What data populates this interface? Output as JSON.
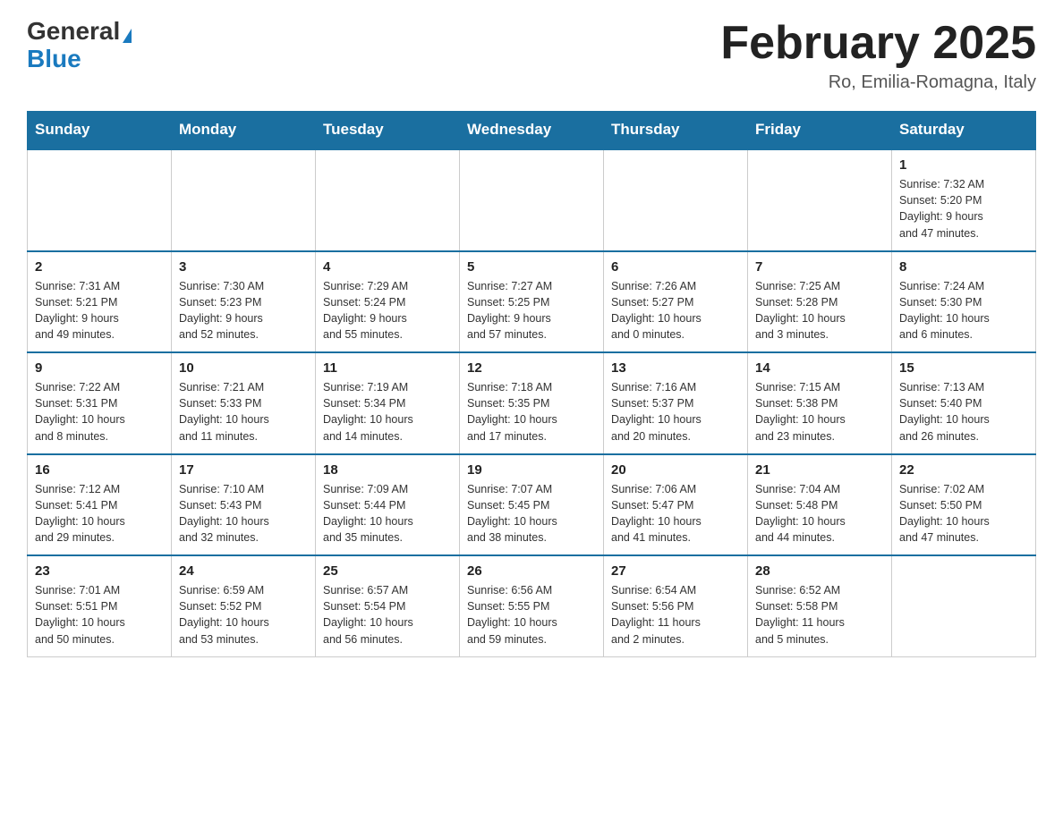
{
  "header": {
    "logo_general": "General",
    "logo_blue": "Blue",
    "month_title": "February 2025",
    "location": "Ro, Emilia-Romagna, Italy"
  },
  "days_of_week": [
    "Sunday",
    "Monday",
    "Tuesday",
    "Wednesday",
    "Thursday",
    "Friday",
    "Saturday"
  ],
  "weeks": [
    [
      {
        "day": "",
        "info": ""
      },
      {
        "day": "",
        "info": ""
      },
      {
        "day": "",
        "info": ""
      },
      {
        "day": "",
        "info": ""
      },
      {
        "day": "",
        "info": ""
      },
      {
        "day": "",
        "info": ""
      },
      {
        "day": "1",
        "info": "Sunrise: 7:32 AM\nSunset: 5:20 PM\nDaylight: 9 hours\nand 47 minutes."
      }
    ],
    [
      {
        "day": "2",
        "info": "Sunrise: 7:31 AM\nSunset: 5:21 PM\nDaylight: 9 hours\nand 49 minutes."
      },
      {
        "day": "3",
        "info": "Sunrise: 7:30 AM\nSunset: 5:23 PM\nDaylight: 9 hours\nand 52 minutes."
      },
      {
        "day": "4",
        "info": "Sunrise: 7:29 AM\nSunset: 5:24 PM\nDaylight: 9 hours\nand 55 minutes."
      },
      {
        "day": "5",
        "info": "Sunrise: 7:27 AM\nSunset: 5:25 PM\nDaylight: 9 hours\nand 57 minutes."
      },
      {
        "day": "6",
        "info": "Sunrise: 7:26 AM\nSunset: 5:27 PM\nDaylight: 10 hours\nand 0 minutes."
      },
      {
        "day": "7",
        "info": "Sunrise: 7:25 AM\nSunset: 5:28 PM\nDaylight: 10 hours\nand 3 minutes."
      },
      {
        "day": "8",
        "info": "Sunrise: 7:24 AM\nSunset: 5:30 PM\nDaylight: 10 hours\nand 6 minutes."
      }
    ],
    [
      {
        "day": "9",
        "info": "Sunrise: 7:22 AM\nSunset: 5:31 PM\nDaylight: 10 hours\nand 8 minutes."
      },
      {
        "day": "10",
        "info": "Sunrise: 7:21 AM\nSunset: 5:33 PM\nDaylight: 10 hours\nand 11 minutes."
      },
      {
        "day": "11",
        "info": "Sunrise: 7:19 AM\nSunset: 5:34 PM\nDaylight: 10 hours\nand 14 minutes."
      },
      {
        "day": "12",
        "info": "Sunrise: 7:18 AM\nSunset: 5:35 PM\nDaylight: 10 hours\nand 17 minutes."
      },
      {
        "day": "13",
        "info": "Sunrise: 7:16 AM\nSunset: 5:37 PM\nDaylight: 10 hours\nand 20 minutes."
      },
      {
        "day": "14",
        "info": "Sunrise: 7:15 AM\nSunset: 5:38 PM\nDaylight: 10 hours\nand 23 minutes."
      },
      {
        "day": "15",
        "info": "Sunrise: 7:13 AM\nSunset: 5:40 PM\nDaylight: 10 hours\nand 26 minutes."
      }
    ],
    [
      {
        "day": "16",
        "info": "Sunrise: 7:12 AM\nSunset: 5:41 PM\nDaylight: 10 hours\nand 29 minutes."
      },
      {
        "day": "17",
        "info": "Sunrise: 7:10 AM\nSunset: 5:43 PM\nDaylight: 10 hours\nand 32 minutes."
      },
      {
        "day": "18",
        "info": "Sunrise: 7:09 AM\nSunset: 5:44 PM\nDaylight: 10 hours\nand 35 minutes."
      },
      {
        "day": "19",
        "info": "Sunrise: 7:07 AM\nSunset: 5:45 PM\nDaylight: 10 hours\nand 38 minutes."
      },
      {
        "day": "20",
        "info": "Sunrise: 7:06 AM\nSunset: 5:47 PM\nDaylight: 10 hours\nand 41 minutes."
      },
      {
        "day": "21",
        "info": "Sunrise: 7:04 AM\nSunset: 5:48 PM\nDaylight: 10 hours\nand 44 minutes."
      },
      {
        "day": "22",
        "info": "Sunrise: 7:02 AM\nSunset: 5:50 PM\nDaylight: 10 hours\nand 47 minutes."
      }
    ],
    [
      {
        "day": "23",
        "info": "Sunrise: 7:01 AM\nSunset: 5:51 PM\nDaylight: 10 hours\nand 50 minutes."
      },
      {
        "day": "24",
        "info": "Sunrise: 6:59 AM\nSunset: 5:52 PM\nDaylight: 10 hours\nand 53 minutes."
      },
      {
        "day": "25",
        "info": "Sunrise: 6:57 AM\nSunset: 5:54 PM\nDaylight: 10 hours\nand 56 minutes."
      },
      {
        "day": "26",
        "info": "Sunrise: 6:56 AM\nSunset: 5:55 PM\nDaylight: 10 hours\nand 59 minutes."
      },
      {
        "day": "27",
        "info": "Sunrise: 6:54 AM\nSunset: 5:56 PM\nDaylight: 11 hours\nand 2 minutes."
      },
      {
        "day": "28",
        "info": "Sunrise: 6:52 AM\nSunset: 5:58 PM\nDaylight: 11 hours\nand 5 minutes."
      },
      {
        "day": "",
        "info": ""
      }
    ]
  ]
}
